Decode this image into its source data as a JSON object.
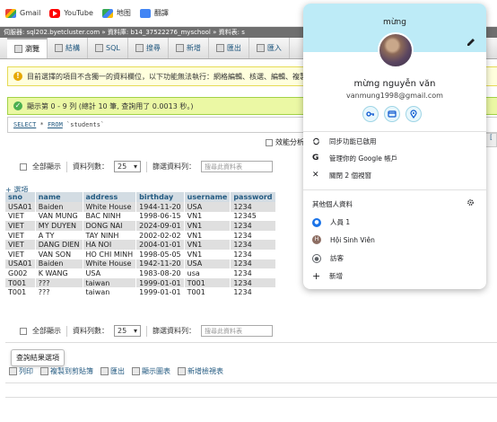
{
  "bookmarks": [
    {
      "label": "Gmail",
      "icon": "gmail-icon"
    },
    {
      "label": "YouTube",
      "icon": "youtube-icon"
    },
    {
      "label": "地图",
      "icon": "maps-icon"
    },
    {
      "label": "翻譯",
      "icon": "translate-icon"
    }
  ],
  "breadcrumb": "伺服器: sql202.byetcluster.com » 資料庫: b14_37522276_myschool » 資料表: s",
  "tabs": [
    {
      "label": "瀏覽",
      "active": true
    },
    {
      "label": "結構",
      "active": false
    },
    {
      "label": "SQL",
      "active": false
    },
    {
      "label": "搜尋",
      "active": false
    },
    {
      "label": "新增",
      "active": false
    },
    {
      "label": "匯出",
      "active": false
    },
    {
      "label": "匯入",
      "active": false
    }
  ],
  "notice": "目前選擇的項目不含獨一的資料欄位，以下功能無法執行：網格編輯、核選、編輯、複製",
  "success": "顯示第 0 - 9 列 (總計 10 筆, 查詢用了 0.0013 秒。)",
  "sql": {
    "keyword1": "SELECT",
    "rest1": " * ",
    "keyword2": "FROM",
    "rest2": " `students`"
  },
  "profiling": "效能分析",
  "controls": {
    "show_all": "全部顯示",
    "rows_label": "資料列數：",
    "rows_value": "25",
    "filter_label": "篩選資料列：",
    "filter_placeholder": "搜尋此資料表"
  },
  "options_link": "+ 選項",
  "table": {
    "headers": [
      "sno",
      "name",
      "address",
      "birthday",
      "username",
      "password"
    ],
    "rows": [
      [
        "USA01",
        "Baiden",
        "White House",
        "1944-11-20",
        "USA",
        "1234"
      ],
      [
        "VIET",
        "VAN MUNG",
        "BAC NINH",
        "1998-06-15",
        "VN1",
        "12345"
      ],
      [
        "VIET",
        "MY DUYEN",
        "DONG NAI",
        "2024-09-01",
        "VN1",
        "1234"
      ],
      [
        "VIET",
        "A TY",
        "TAY NINH",
        "2002-02-02",
        "VN1",
        "1234"
      ],
      [
        "VIET",
        "DANG DIEN",
        "HA NOI",
        "2004-01-01",
        "VN1",
        "1234"
      ],
      [
        "VIET",
        "VAN SON",
        "HO CHI MINH",
        "1998-05-05",
        "VN1",
        "1234"
      ],
      [
        "USA01",
        "Baiden",
        "White House",
        "1942-11-20",
        "USA",
        "1234"
      ],
      [
        "G002",
        "K WANG",
        "USA",
        "1983-08-20",
        "usa",
        "1234"
      ],
      [
        "T001",
        "???",
        "taiwan",
        "1999-01-01",
        "T001",
        "1234"
      ],
      [
        "T001",
        "???",
        "taiwan",
        "1999-01-01",
        "T001",
        "1234"
      ]
    ]
  },
  "query_tip": "查詢結果選項",
  "ops": [
    "列印",
    "複製到剪貼簿",
    "匯出",
    "顯示圖表",
    "新增檢視表"
  ],
  "right_edge": "[",
  "popup": {
    "top_name": "mừng",
    "name": "mừng nguyễn văn",
    "email": "vanmung1998@gmail.com",
    "menu": [
      {
        "label": "同步功能已啟用",
        "icon": "sync-icon"
      },
      {
        "label": "管理你的 Google 帳戶",
        "icon": "google-icon"
      },
      {
        "label": "關閉 2 個視窗",
        "icon": "close-icon"
      }
    ],
    "section_title": "其他個人資料",
    "profiles": [
      {
        "label": "人員 1",
        "icon": "person-icon",
        "color": "#1a73e8"
      },
      {
        "label": "Hội Sinh Viên",
        "icon": "profile-avatar-icon",
        "color": "#8d6e63",
        "initial": "H"
      },
      {
        "label": "訪客",
        "icon": "guest-icon",
        "color": "#5f6368"
      },
      {
        "label": "新增",
        "icon": "add-icon",
        "color": "#202124"
      }
    ]
  }
}
